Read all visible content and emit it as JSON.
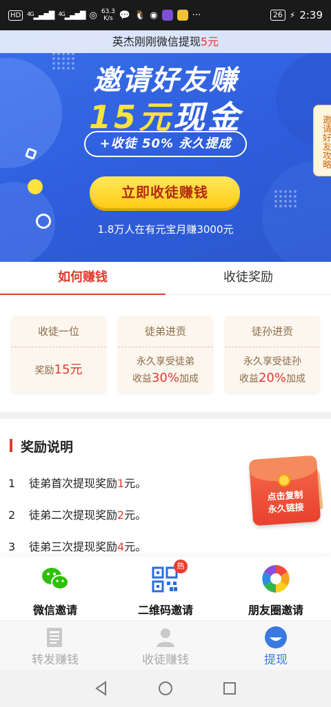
{
  "status_bar": {
    "hd": "HD",
    "net1": "4G",
    "net2": "4G",
    "speed_value": "63.3",
    "speed_unit": "K/s",
    "more": "···",
    "battery": "26",
    "time": "2:39"
  },
  "hero": {
    "ticker_prefix": "英杰刚刚微信提现",
    "ticker_amount": "5元",
    "title_line1": "邀请好友赚",
    "title_line2_yellow": "15元",
    "title_line2_white": "现金",
    "pill": "+收徒 50% 永久提成",
    "cta": "立即收徒赚钱",
    "subtext": "1.8万人在有元宝月赚3000元",
    "strategy_tab": "邀请好友攻略"
  },
  "tabs": [
    {
      "label": "如何赚钱"
    },
    {
      "label": "收徒奖励"
    }
  ],
  "cards": [
    {
      "top": "收徒一位",
      "line1_prefix": "奖励",
      "line1_hl": "15元",
      "line2_prefix": "",
      "line2_hl": "",
      "line2_suffix": ""
    },
    {
      "top": "徒弟进贡",
      "line1_prefix": "永久享受徒弟",
      "line1_hl": "",
      "line2_prefix": "收益",
      "line2_hl": "30%",
      "line2_suffix": "加成"
    },
    {
      "top": "徒孙进贡",
      "line1_prefix": "永久享受徒孙",
      "line1_hl": "",
      "line2_prefix": "收益",
      "line2_hl": "20%",
      "line2_suffix": "加成"
    }
  ],
  "description": {
    "title": "奖励说明",
    "items": [
      {
        "num": "1",
        "prefix": "徒弟首次提现奖励",
        "hl": "1",
        "suffix": "元。"
      },
      {
        "num": "2",
        "prefix": "徒弟二次提现奖励",
        "hl": "2",
        "suffix": "元。"
      },
      {
        "num": "3",
        "prefix": "徒弟三次提现奖励",
        "hl": "4",
        "suffix": "元。"
      }
    ],
    "envelope_line1": "点击复制",
    "envelope_line2": "永久链接"
  },
  "share": [
    {
      "label": "微信邀请",
      "icon": "wechat-icon"
    },
    {
      "label": "二维码邀请",
      "icon": "qrcode-icon",
      "badge": "热"
    },
    {
      "label": "朋友圈邀请",
      "icon": "moments-icon"
    }
  ],
  "tabbar": [
    {
      "label": "转发赚钱",
      "icon": "news-icon"
    },
    {
      "label": "收徒赚钱",
      "icon": "user-icon"
    },
    {
      "label": "提现",
      "icon": "withdraw-icon"
    }
  ],
  "colors": {
    "accent_red": "#e03a2f",
    "hero_blue": "#2f5fde",
    "cta_yellow": "#ffd62a",
    "tab_active_blue": "#3a79e0"
  }
}
